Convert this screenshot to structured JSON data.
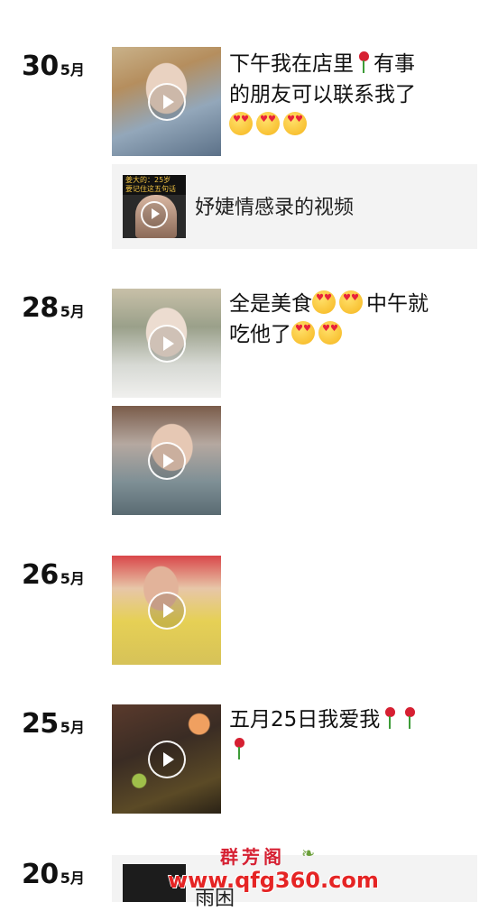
{
  "posts": [
    {
      "day": "30",
      "month": "5月",
      "caption_line1": "下午我在店里",
      "caption_line1b": "有事",
      "caption_line2": "的朋友可以联系我了",
      "share": {
        "thumb_top": "姜大的：25岁",
        "thumb_sub": "要记住这五句话",
        "title": "妤婕情感录的视频"
      }
    },
    {
      "day": "28",
      "month": "5月",
      "caption_line1": "全是美食",
      "caption_line1b": "中午就",
      "caption_line2": "吃他了"
    },
    {
      "day": "26",
      "month": "5月"
    },
    {
      "day": "25",
      "month": "5月",
      "caption_line1": "五月25日我爱我"
    },
    {
      "day": "20",
      "month": "5月",
      "partial_text": "雨困"
    }
  ],
  "watermark": {
    "brand": "群芳阁",
    "url": "www.qfg360.com"
  },
  "icons": [
    "play-icon",
    "heart-eyes-emoji",
    "rose-emoji"
  ],
  "colors": {
    "accent": "#d62032",
    "share_bg": "#f3f3f3"
  }
}
